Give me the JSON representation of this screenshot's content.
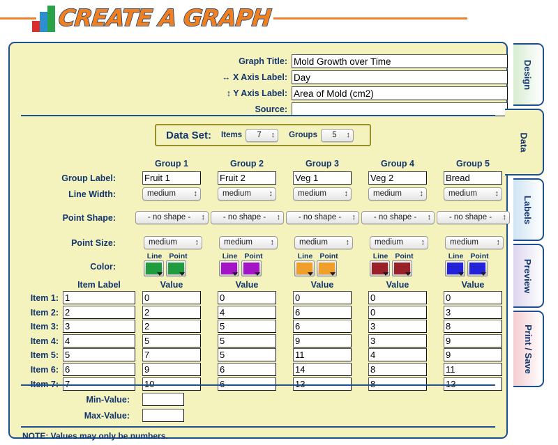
{
  "logo": {
    "text": "CREATE A GRAPH",
    "bar_colors": [
      "#d8302c",
      "#2e8fd0",
      "#2aa24a"
    ],
    "rule_color": "#ef8230"
  },
  "tabs": [
    {
      "label": "Design",
      "active": false,
      "color": "#d8ecd2"
    },
    {
      "label": "Data",
      "active": true,
      "color": "#f4f2bd"
    },
    {
      "label": "Labels",
      "active": false,
      "color": "#cfe4f3"
    },
    {
      "label": "Preview",
      "active": false,
      "color": "#ddd5ee"
    },
    {
      "label": "Print / Save",
      "active": false,
      "color": "#f4cdd0"
    }
  ],
  "graph_info": {
    "fields": [
      {
        "label": "Graph Title:",
        "icon": "",
        "value": "Mold Growth over Time"
      },
      {
        "label": "X Axis Label:",
        "icon": "↔",
        "value": "Day"
      },
      {
        "label": "Y Axis Label:",
        "icon": "↕",
        "value": "Area of Mold (cm2)"
      },
      {
        "label": "Source:",
        "icon": "",
        "value": ""
      }
    ]
  },
  "dataset": {
    "title": "Data Set:",
    "items_label": "Items",
    "items_value": "7",
    "groups_label": "Groups",
    "groups_value": "5"
  },
  "row_labels": {
    "group_label": "Group Label:",
    "line_width": "Line Width:",
    "point_shape": "Point Shape:",
    "point_size": "Point Size:",
    "color": "Color:",
    "line_sub": "Line",
    "point_sub": "Point",
    "item_label_header": "Item Label",
    "value_header": "Value",
    "min_value": "Min-Value:",
    "max_value": "Max-Value:"
  },
  "groups": [
    {
      "header": "Group 1",
      "label": "Fruit 1",
      "line_width": "medium",
      "point_shape": "- no shape -",
      "point_size": "medium",
      "line_color": "#1f9c3f",
      "point_color": "#1f9c3f"
    },
    {
      "header": "Group 2",
      "label": "Fruit 2",
      "line_width": "medium",
      "point_shape": "- no shape -",
      "point_size": "medium",
      "line_color": "#a413c4",
      "point_color": "#a413c4"
    },
    {
      "header": "Group 3",
      "label": "Veg 1",
      "line_width": "medium",
      "point_shape": "- no shape -",
      "point_size": "medium",
      "line_color": "#f0a02a",
      "point_color": "#f0a02a"
    },
    {
      "header": "Group 4",
      "label": "Veg 2",
      "line_width": "medium",
      "point_shape": "- no shape -",
      "point_size": "medium",
      "line_color": "#992229",
      "point_color": "#992229"
    },
    {
      "header": "Group 5",
      "label": "Bread",
      "line_width": "medium",
      "point_shape": "- no shape -",
      "point_size": "medium",
      "line_color": "#2222d8",
      "point_color": "#2222d8"
    }
  ],
  "items": [
    {
      "row_label": "Item 1:",
      "item_label": "1"
    },
    {
      "row_label": "Item 2:",
      "item_label": "2"
    },
    {
      "row_label": "Item 3:",
      "item_label": "3"
    },
    {
      "row_label": "Item 4:",
      "item_label": "4"
    },
    {
      "row_label": "Item 5:",
      "item_label": "5"
    },
    {
      "row_label": "Item 6:",
      "item_label": "6"
    },
    {
      "row_label": "Item 7:",
      "item_label": "7"
    }
  ],
  "values": [
    [
      "0",
      "2",
      "2",
      "5",
      "7",
      "9",
      "10"
    ],
    [
      "0",
      "4",
      "5",
      "5",
      "5",
      "6",
      "6"
    ],
    [
      "0",
      "6",
      "6",
      "9",
      "11",
      "14",
      "13"
    ],
    [
      "0",
      "0",
      "3",
      "3",
      "4",
      "8",
      "8"
    ],
    [
      "0",
      "3",
      "8",
      "9",
      "9",
      "11",
      "13"
    ]
  ],
  "min_value_field": "",
  "max_value_field": "",
  "note": "NOTE: Values may only be numbers.",
  "chart_data": {
    "type": "table",
    "title": "Mold Growth over Time",
    "xlabel": "Day",
    "ylabel": "Area of Mold (cm2)",
    "categories": [
      "1",
      "2",
      "3",
      "4",
      "5",
      "6",
      "7"
    ],
    "series": [
      {
        "name": "Fruit 1",
        "color": "#1f9c3f",
        "values": [
          0,
          2,
          2,
          5,
          7,
          9,
          10
        ]
      },
      {
        "name": "Fruit 2",
        "color": "#a413c4",
        "values": [
          0,
          4,
          5,
          5,
          5,
          6,
          6
        ]
      },
      {
        "name": "Veg 1",
        "color": "#f0a02a",
        "values": [
          0,
          6,
          6,
          9,
          11,
          14,
          13
        ]
      },
      {
        "name": "Veg 2",
        "color": "#992229",
        "values": [
          0,
          0,
          3,
          3,
          4,
          8,
          8
        ]
      },
      {
        "name": "Bread",
        "color": "#2222d8",
        "values": [
          0,
          3,
          8,
          9,
          9,
          11,
          13
        ]
      }
    ]
  }
}
